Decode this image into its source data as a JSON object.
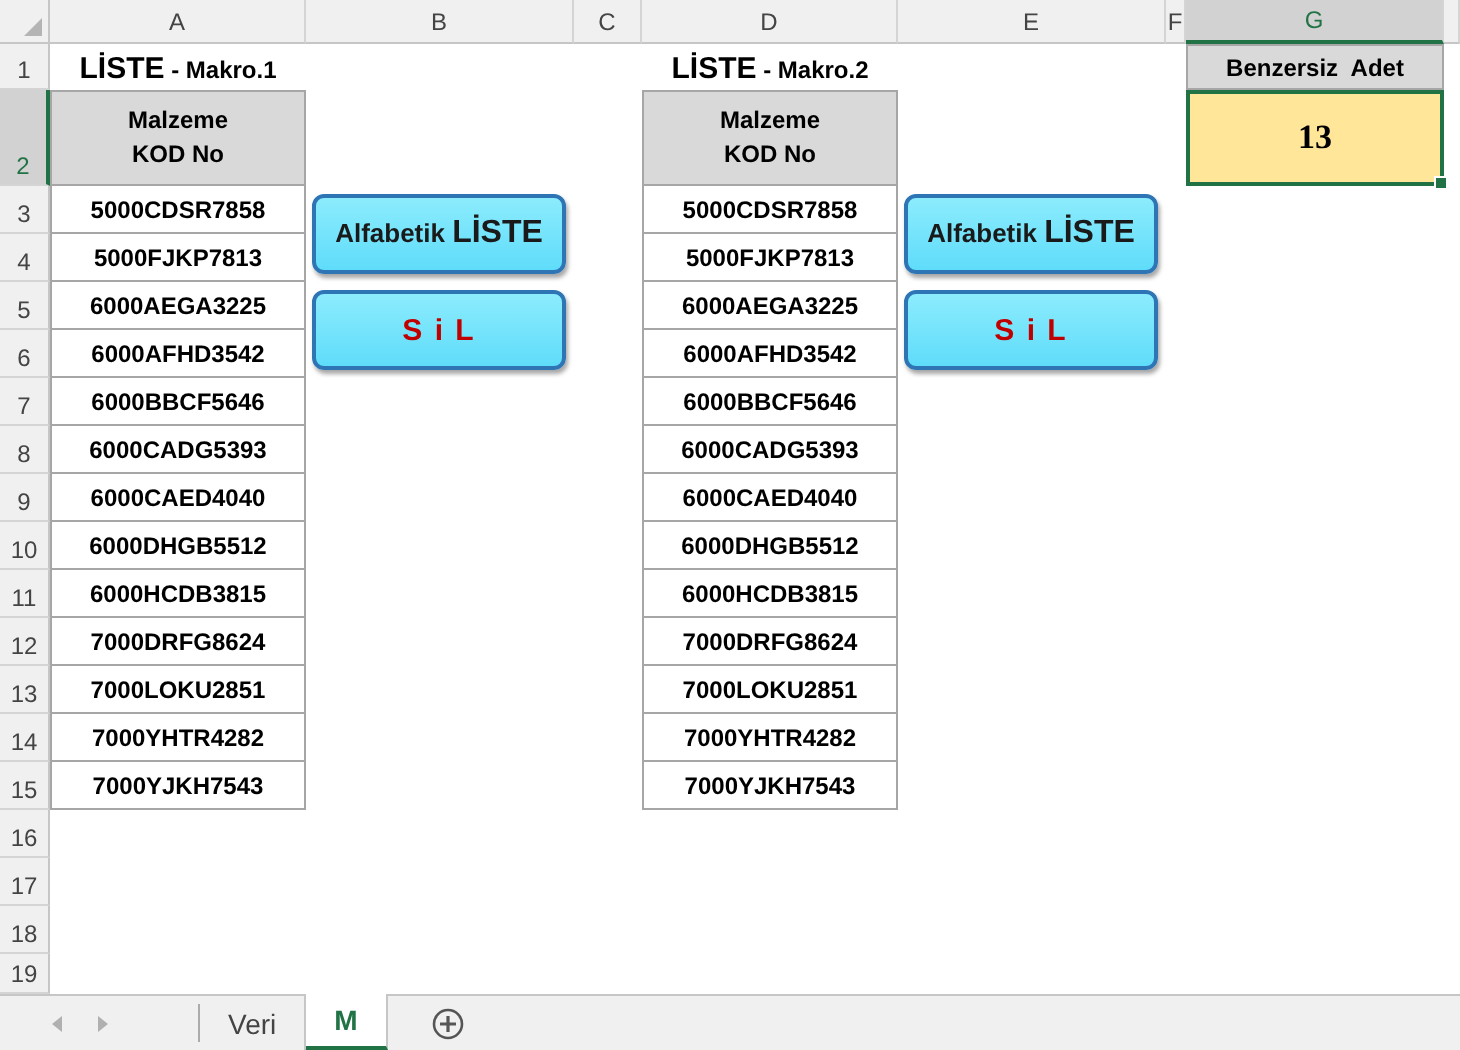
{
  "column_headers": [
    {
      "label": "A",
      "selected": false
    },
    {
      "label": "B",
      "selected": false
    },
    {
      "label": "C",
      "selected": false
    },
    {
      "label": "D",
      "selected": false
    },
    {
      "label": "E",
      "selected": false
    },
    {
      "label": "F",
      "selected": false
    },
    {
      "label": "G",
      "selected": true
    }
  ],
  "row_numbers": [
    {
      "label": "1",
      "selected": false
    },
    {
      "label": "2",
      "selected": true
    },
    {
      "label": "3",
      "selected": false
    },
    {
      "label": "4",
      "selected": false
    },
    {
      "label": "5",
      "selected": false
    },
    {
      "label": "6",
      "selected": false
    },
    {
      "label": "7",
      "selected": false
    },
    {
      "label": "8",
      "selected": false
    },
    {
      "label": "9",
      "selected": false
    },
    {
      "label": "10",
      "selected": false
    },
    {
      "label": "11",
      "selected": false
    },
    {
      "label": "12",
      "selected": false
    },
    {
      "label": "13",
      "selected": false
    },
    {
      "label": "14",
      "selected": false
    },
    {
      "label": "15",
      "selected": false
    },
    {
      "label": "16",
      "selected": false
    },
    {
      "label": "17",
      "selected": false
    },
    {
      "label": "18",
      "selected": false
    },
    {
      "label": "19",
      "selected": false
    }
  ],
  "lists": [
    {
      "title": "**LİSTE** - Makro.1",
      "header": "Malzeme\nKOD No",
      "codes": [
        "5000CDSR7858",
        "5000FJKP7813",
        "6000AEGA3225",
        "6000AFHD3542",
        "6000BBCF5646",
        "6000CADG5393",
        "6000CAED4040",
        "6000DHGB5512",
        "6000HCDB3815",
        "7000DRFG8624",
        "7000LOKU2851",
        "7000YHTR4282",
        "7000YJKH7543"
      ],
      "buttons": [
        {
          "label": "Alfabetik **LİSTE**",
          "kind": "sort"
        },
        {
          "label": "S i L",
          "kind": "delete"
        }
      ]
    },
    {
      "title": "**LİSTE** - Makro.2",
      "header": "Malzeme\nKOD No",
      "codes": [
        "5000CDSR7858",
        "5000FJKP7813",
        "6000AEGA3225",
        "6000AFHD3542",
        "6000BBCF5646",
        "6000CADG5393",
        "6000CAED4040",
        "6000DHGB5512",
        "6000HCDB3815",
        "7000DRFG8624",
        "7000LOKU2851",
        "7000YHTR4282",
        "7000YJKH7543"
      ],
      "buttons": [
        {
          "label": "Alfabetik **LİSTE**",
          "kind": "sort"
        },
        {
          "label": "S i L",
          "kind": "delete"
        }
      ]
    }
  ],
  "unique_count": {
    "label": "Benzersiz  Adet",
    "value": "13",
    "selected": true
  },
  "sheet_tabs": [
    {
      "label": "Veri",
      "selected": false
    },
    {
      "label": "M",
      "selected": true
    }
  ]
}
